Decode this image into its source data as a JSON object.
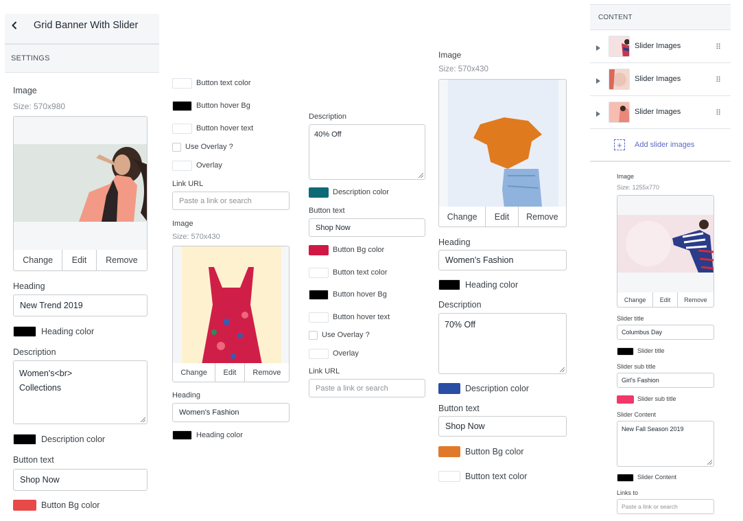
{
  "panel_one": {
    "title": "Grid Banner With Slider",
    "settings_header": "SETTINGS",
    "image_label": "Image",
    "image_size": "Size: 570x980",
    "change_label": "Change",
    "edit_label": "Edit",
    "remove_label": "Remove",
    "heading_label": "Heading",
    "heading_value": "New Trend 2019",
    "heading_color_label": "Heading color",
    "heading_color": "#000000",
    "description_label": "Description",
    "description_value": "Women's<br>\nCollections",
    "description_color_label": "Description color",
    "description_color": "#000000",
    "button_text_label": "Button text",
    "button_text_value": "Shop Now",
    "button_bg_label": "Button Bg color",
    "button_bg_color": "#e84a4a"
  },
  "panel_two": {
    "button_text_color_label": "Button text color",
    "button_hover_bg_label": "Button hover Bg",
    "button_hover_bg_color": "#000000",
    "button_hover_text_label": "Button hover text",
    "use_overlay_label": "Use Overlay ?",
    "overlay_label": "Overlay",
    "link_url_label": "Link URL",
    "link_url_placeholder": "Paste a link or search",
    "image_label": "Image",
    "image_size": "Size: 570x430",
    "change_label": "Change",
    "edit_label": "Edit",
    "remove_label": "Remove",
    "heading_label": "Heading",
    "heading_value": "Women's Fashion",
    "heading_color_label": "Heading color",
    "heading_color": "#000000"
  },
  "panel_three": {
    "description_label": "Description",
    "description_value": "40% Off",
    "description_color_label": "Description color",
    "description_color": "#0f6a78",
    "button_text_label": "Button text",
    "button_text_value": "Shop Now",
    "button_bg_label": "Button Bg color",
    "button_bg_color": "#d01845",
    "button_text_color_label": "Button text color",
    "button_hover_bg_label": "Button hover Bg",
    "button_hover_bg_color": "#000000",
    "button_hover_text_label": "Button hover text",
    "use_overlay_label": "Use Overlay ?",
    "overlay_label": "Overlay",
    "link_url_label": "Link URL",
    "link_url_placeholder": "Paste a link or search"
  },
  "panel_four": {
    "image_label": "Image",
    "image_size": "Size: 570x430",
    "change_label": "Change",
    "edit_label": "Edit",
    "remove_label": "Remove",
    "heading_label": "Heading",
    "heading_value": "Women's Fashion",
    "heading_color_label": "Heading color",
    "heading_color": "#000000",
    "description_label": "Description",
    "description_value": "70% Off",
    "description_color_label": "Description color",
    "description_color": "#2a4ea4",
    "button_text_label": "Button text",
    "button_text_value": "Shop Now",
    "button_bg_label": "Button Bg color",
    "button_bg_color": "#e07a2a",
    "button_text_color_label": "Button text color"
  },
  "panel_five": {
    "content_header": "CONTENT",
    "slider_items": [
      {
        "label": "Slider Images"
      },
      {
        "label": "Slider Images"
      },
      {
        "label": "Slider Images"
      }
    ],
    "add_slider_label": "Add slider images",
    "image_label": "Image",
    "image_size": "Size: 1255x770",
    "change_label": "Change",
    "edit_label": "Edit",
    "remove_label": "Remove",
    "slider_title_label": "Slider title",
    "slider_title_value": "Columbus Day",
    "slider_title_color_label": "Slider title",
    "slider_title_color": "#000000",
    "slider_sub_title_label": "Slider sub title",
    "slider_sub_title_value": "Girl's Fashion",
    "slider_sub_title_color_label": "Slider sub title",
    "slider_sub_title_color": "#f0386a",
    "slider_content_label": "Slider Content",
    "slider_content_value": "New Fall Season 2019",
    "slider_content_color_label": "Slider Content",
    "slider_content_color": "#000000",
    "links_to_label": "Links to",
    "links_to_placeholder": "Paste a link or search"
  },
  "colors": {
    "accent": "#5c6ac4",
    "border": "#c9cccf"
  }
}
